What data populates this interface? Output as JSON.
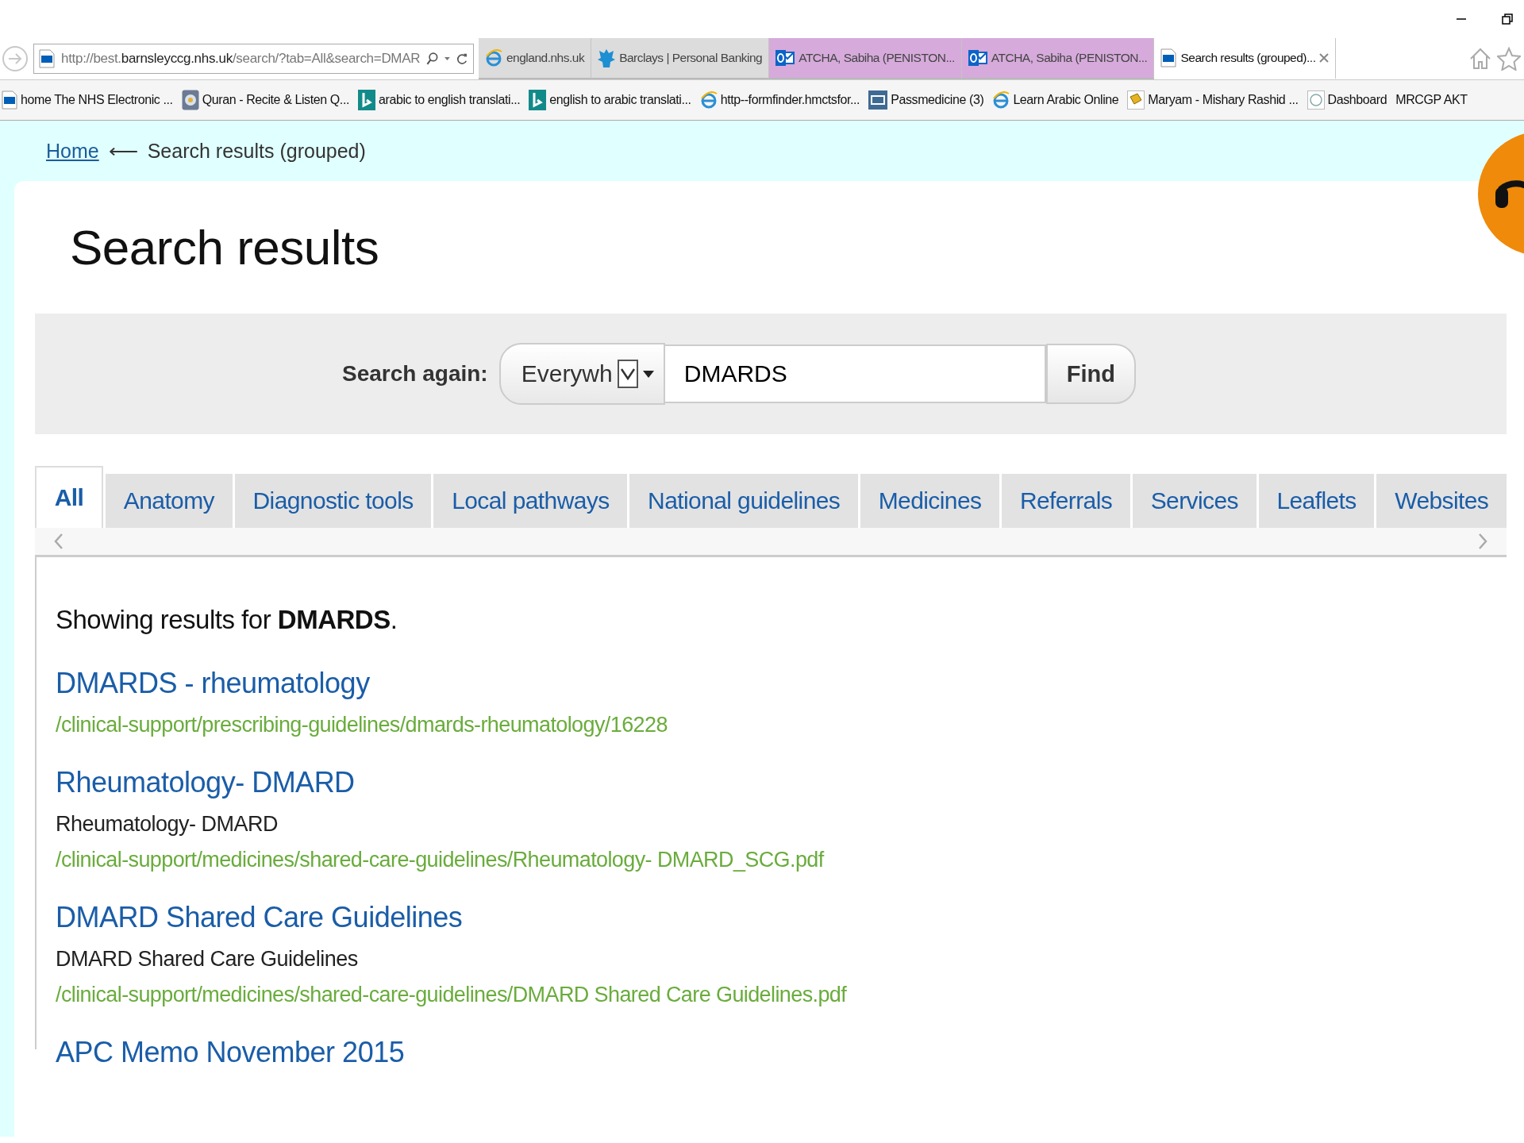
{
  "address_bar": {
    "url": "http://best.**barnsleyccg.nhs.uk**/search/?tab=All&search=DMAR"
  },
  "browser_tabs": [
    {
      "label": "england.nhs.uk",
      "kind": "ie",
      "selected": false,
      "color": "#dcdcdc"
    },
    {
      "label": "Barclays | Personal Banking",
      "kind": "bank",
      "selected": false,
      "color": "#dcdcdc"
    },
    {
      "label": "ATCHA, Sabiha (PENISTON...",
      "kind": "mail",
      "selected": false,
      "color": "#d6aadb"
    },
    {
      "label": "ATCHA, Sabiha (PENISTON...",
      "kind": "mail",
      "selected": false,
      "color": "#d6aadb"
    },
    {
      "label": "Search results (grouped)...",
      "kind": "nhs",
      "selected": true,
      "color": "#ffffff"
    }
  ],
  "bookmarks": [
    {
      "label": "home The NHS Electronic ...",
      "kind": "nhs"
    },
    {
      "label": "Quran - Recite & Listen Q...",
      "kind": "globe"
    },
    {
      "label": "arabic to english translati...",
      "kind": "tile"
    },
    {
      "label": "english to arabic translati...",
      "kind": "tile"
    },
    {
      "label": "http--formfinder.hmctsfor...",
      "kind": "ie"
    },
    {
      "label": "Passmedicine (3)",
      "kind": "pm"
    },
    {
      "label": "Learn Arabic Online",
      "kind": "ie"
    },
    {
      "label": "Maryam - Mishary Rashid ...",
      "kind": "book"
    },
    {
      "label": "Dashboard",
      "kind": "circle"
    },
    {
      "label": "MRCGP AKT",
      "kind": "none"
    }
  ],
  "breadcrumb": {
    "home": "Home",
    "separator": "⟵",
    "current": "Search results (grouped)"
  },
  "page_title": "Search results",
  "search": {
    "label": "Search again:",
    "scope": "Everywh",
    "query": "DMARDS",
    "button": "Find"
  },
  "tabs": [
    {
      "label": "All",
      "selected": true
    },
    {
      "label": "Anatomy",
      "selected": false
    },
    {
      "label": "Diagnostic tools",
      "selected": false
    },
    {
      "label": "Local pathways",
      "selected": false
    },
    {
      "label": "National guidelines",
      "selected": false
    },
    {
      "label": "Medicines",
      "selected": false
    },
    {
      "label": "Referrals",
      "selected": false
    },
    {
      "label": "Services",
      "selected": false
    },
    {
      "label": "Leaflets",
      "selected": false
    },
    {
      "label": "Websites",
      "selected": false
    }
  ],
  "summary": "Showing results for **DMARDS**.",
  "results": [
    {
      "title": "DMARDS - rheumatology",
      "url": "/clinical-support/prescribing-guidelines/dmards-rheumatology/16228"
    },
    {
      "title": "Rheumatology- DMARD",
      "snippet": "Rheumatology- DMARD",
      "url": "/clinical-support/medicines/shared-care-guidelines/Rheumatology- DMARD_SCG.pdf"
    },
    {
      "title": "DMARD Shared Care Guidelines",
      "snippet": "DMARD Shared Care Guidelines",
      "url": "/clinical-support/medicines/shared-care-guidelines/DMARD Shared Care Guidelines.pdf"
    },
    {
      "title": "APC Memo November 2015"
    }
  ]
}
